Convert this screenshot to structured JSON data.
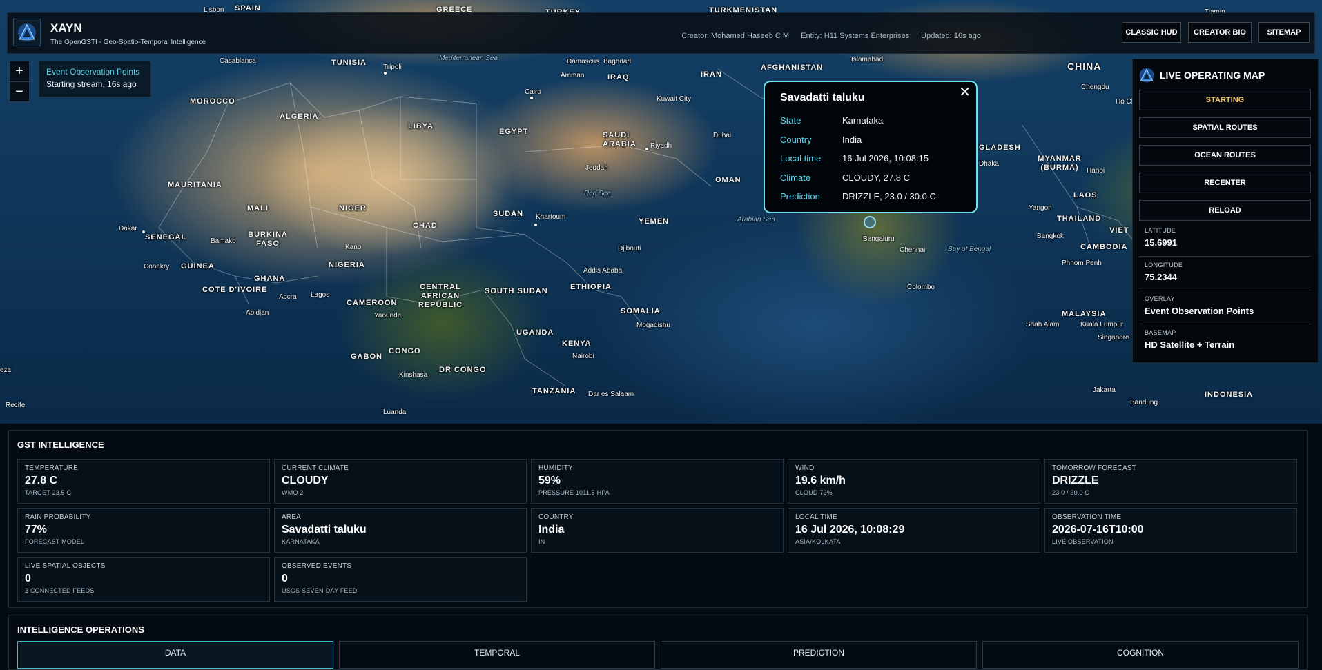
{
  "header": {
    "title": "XAYN",
    "subtitle": "The OpenGSTI - Geo-Spatio-Temporal Intelligence",
    "creator": "Creator: Mohamed Haseeb C M",
    "entity": "Entity: H11 Systems Enterprises",
    "updated": "Updated: 16s ago",
    "buttons": [
      "CLASSIC HUD",
      "CREATOR BIO",
      "SITEMAP"
    ]
  },
  "map": {
    "zoom_in": "+",
    "zoom_out": "−",
    "overlay_tag": {
      "title": "Event Observation Points",
      "status": "Starting stream, 16s ago"
    },
    "labels": {
      "countries": [
        "SPAIN",
        "GREECE",
        "TURKEY",
        "TURKMENISTAN",
        "TUNISIA",
        "MOROCCO",
        "ALGERIA",
        "LIBYA",
        "EGYPT",
        "IRAQ",
        "IRAN",
        "AFGHANISTAN",
        "CHINA",
        "SAUDI ARABIA",
        "OMAN",
        "YEMEN",
        "MAURITANIA",
        "MALI",
        "NIGER",
        "CHAD",
        "SUDAN",
        "SENEGAL",
        "BURKINA FASO",
        "GUINEA",
        "GHANA",
        "NIGERIA",
        "CAMEROON",
        "CENTRAL AFRICAN REPUBLIC",
        "SOUTH SUDAN",
        "ETHIOPIA",
        "SOMALIA",
        "UGANDA",
        "KENYA",
        "GABON",
        "CONGO",
        "DR CONGO",
        "TANZANIA",
        "MYANMAR (BURMA)",
        "LAOS",
        "THAILAND",
        "CAMBODIA",
        "MALAYSIA",
        "INDONESIA",
        "COTE D'IVOIRE",
        "GLADESH",
        "VIET"
      ],
      "cities": [
        "Lisbon",
        "Casablanca",
        "Tripoli",
        "Damascus",
        "Baghdad",
        "Amman",
        "Cairo",
        "Kuwait City",
        "Islamabad",
        "Dubai",
        "Riyadh",
        "Jeddah",
        "Khartoum",
        "Dakar",
        "Bamako",
        "Kano",
        "Conakry",
        "Accra",
        "Lagos",
        "Abidjan",
        "Yaounde",
        "Addis Ababa",
        "Djibouti",
        "Mogadishu",
        "Nairobi",
        "Kinshasa",
        "Luanda",
        "Dar es Salaam",
        "Recife",
        "Bengaluru",
        "Chennai",
        "Colombo",
        "Chengdu",
        "Dhaka",
        "Yangon",
        "Bangkok",
        "Phnom Penh",
        "Kuala Lumpur",
        "Singapore",
        "Jakarta",
        "Bandung",
        "Shah Alam",
        "Hanoi",
        "Tiamin",
        "Ho Ch",
        "eza"
      ],
      "seas": [
        "Mediterranean Sea",
        "Red Sea",
        "Arabian Sea",
        "Bay of Bengal"
      ]
    }
  },
  "popup": {
    "title": "Savadatti taluku",
    "close": "✕",
    "rows": [
      {
        "key": "State",
        "value": "Karnataka"
      },
      {
        "key": "Country",
        "value": "India"
      },
      {
        "key": "Local time",
        "value": "16 Jul 2026, 10:08:15"
      },
      {
        "key": "Climate",
        "value": "CLOUDY, 27.8 C"
      },
      {
        "key": "Prediction",
        "value": "DRIZZLE, 23.0 / 30.0 C"
      }
    ]
  },
  "right_panel": {
    "title": "LIVE OPERATING MAP",
    "buttons": [
      "STARTING",
      "SPATIAL ROUTES",
      "OCEAN ROUTES",
      "RECENTER",
      "RELOAD"
    ],
    "fields": [
      {
        "label": "LATITUDE",
        "value": "15.6991"
      },
      {
        "label": "LONGITUDE",
        "value": "75.2344"
      },
      {
        "label": "OVERLAY",
        "value": "Event Observation Points"
      },
      {
        "label": "BASEMAP",
        "value": "HD Satellite + Terrain"
      }
    ]
  },
  "gst": {
    "title": "GST INTELLIGENCE",
    "cards": [
      {
        "label": "TEMPERATURE",
        "value": "27.8 C",
        "sub": "TARGET 23.5 C"
      },
      {
        "label": "CURRENT CLIMATE",
        "value": "CLOUDY",
        "sub": "WMO 2"
      },
      {
        "label": "HUMIDITY",
        "value": "59%",
        "sub": "PRESSURE 1011.5 HPA"
      },
      {
        "label": "WIND",
        "value": "19.6 km/h",
        "sub": "CLOUD 72%"
      },
      {
        "label": "TOMORROW FORECAST",
        "value": "DRIZZLE",
        "sub": "23.0 / 30.0 C"
      },
      {
        "label": "RAIN PROBABILITY",
        "value": "77%",
        "sub": "FORECAST MODEL"
      },
      {
        "label": "AREA",
        "value": "Savadatti taluku",
        "sub": "KARNATAKA"
      },
      {
        "label": "COUNTRY",
        "value": "India",
        "sub": "IN"
      },
      {
        "label": "LOCAL TIME",
        "value": "16 Jul 2026, 10:08:29",
        "sub": "ASIA/KOLKATA"
      },
      {
        "label": "OBSERVATION TIME",
        "value": "2026-07-16T10:00",
        "sub": "LIVE OBSERVATION"
      },
      {
        "label": "LIVE SPATIAL OBJECTS",
        "value": "0",
        "sub": "3 CONNECTED FEEDS"
      },
      {
        "label": "OBSERVED EVENTS",
        "value": "0",
        "sub": "USGS SEVEN-DAY FEED"
      }
    ]
  },
  "ops": {
    "title": "INTELLIGENCE OPERATIONS",
    "tabs": [
      "DATA",
      "TEMPORAL",
      "PREDICTION",
      "COGNITION"
    ],
    "active_tab": "DATA"
  },
  "colors": {
    "accent": "#5fd7f0",
    "popup_border": "#6be0ee",
    "active_button": "#f0c26c"
  },
  "icons": {
    "logo": "xayn-triangle-logo-icon",
    "close": "close-icon"
  }
}
